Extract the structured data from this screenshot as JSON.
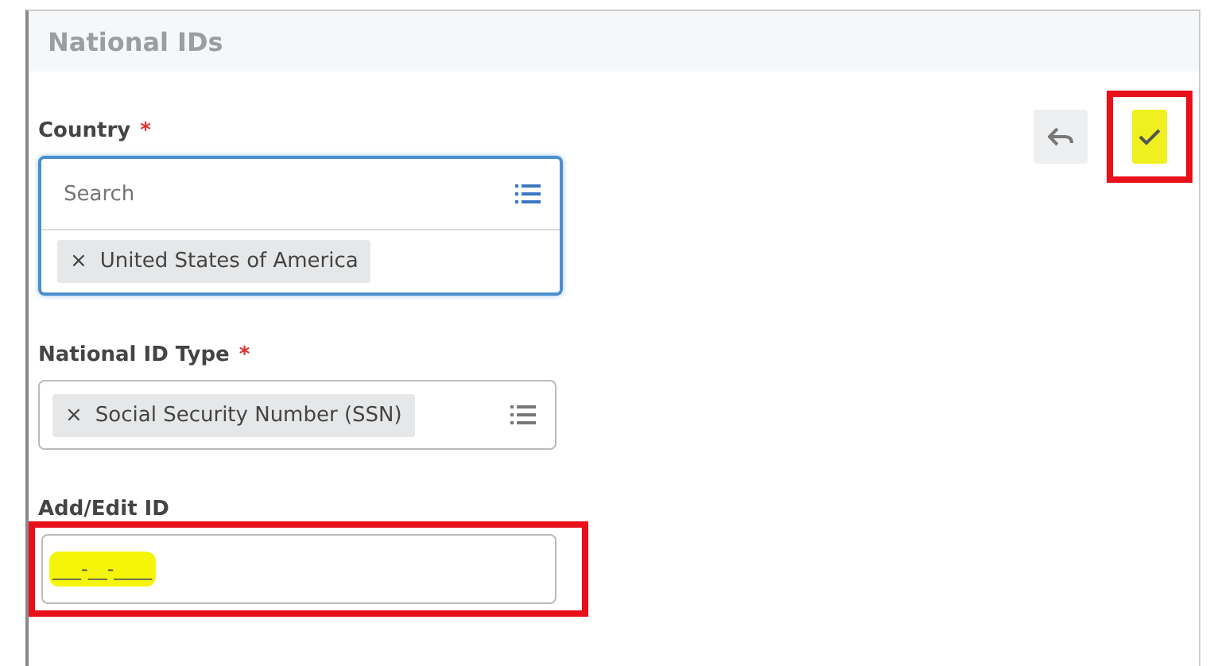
{
  "panel": {
    "title": "National IDs"
  },
  "actions": [
    {
      "kind": "undo",
      "highlighted": false,
      "boxed": false
    },
    {
      "kind": "confirm",
      "highlighted": true,
      "boxed": true
    }
  ],
  "fields": [
    {
      "kind": "multiselect",
      "label": "Country",
      "required_mark": "*",
      "focused": true,
      "placeholder": "Search",
      "chips": [
        {
          "remove": "×",
          "label": "United States of America"
        }
      ],
      "boxed": false,
      "highlighted": false
    },
    {
      "kind": "select",
      "label": "National ID Type",
      "required_mark": "*",
      "focused": false,
      "chips": [
        {
          "remove": "×",
          "label": "Social Security Number (SSN)"
        }
      ],
      "boxed": false,
      "highlighted": false
    },
    {
      "kind": "text",
      "label": "Add/Edit ID",
      "focused": false,
      "value": "___-__-____",
      "boxed": true,
      "highlighted": true
    }
  ]
}
